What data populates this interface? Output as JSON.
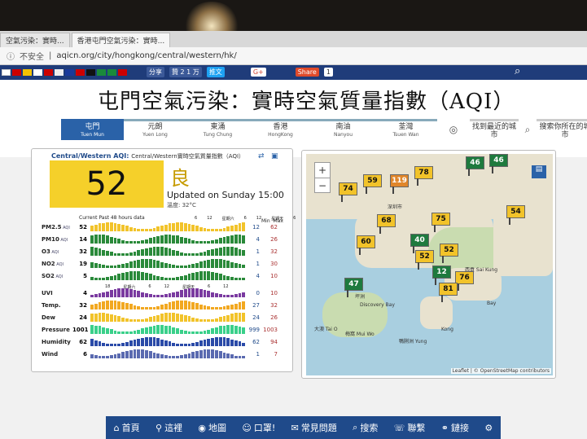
{
  "browser": {
    "tabs": [
      {
        "label": "空氣污染：實時..."
      },
      {
        "label": "香港屯門空氣污染：實時..."
      }
    ],
    "security": "不安全",
    "url": "aqicn.org/city/hongkong/central/western/hk/"
  },
  "social": {
    "share1": "分享",
    "likes": "贊 2 1 万",
    "tweet": "推文",
    "gplus": "G+",
    "share2": "Share",
    "count": "1"
  },
  "page_title": "屯門空氣污染：實時空氣質量指數（AQI）",
  "nav": [
    {
      "zh": "屯門",
      "en": "Tuen Mun"
    },
    {
      "zh": "元朗",
      "en": "Yuen Long"
    },
    {
      "zh": "東涌",
      "en": "Tung Chung"
    },
    {
      "zh": "香港",
      "en": "HongKong"
    },
    {
      "zh": "南油",
      "en": "Nanyou"
    },
    {
      "zh": "荃灣",
      "en": "Tsuen Wan"
    }
  ],
  "nav_right": [
    {
      "label": "找到最近的城市"
    },
    {
      "label": "搜索你所在的城市"
    }
  ],
  "station": {
    "name": "Central/Western",
    "head_suffix": "AQI:",
    "head_desc": "Central/Western實時空氣質量指數（AQI）",
    "aqi": "52",
    "level": "良",
    "updated": "Updated on Sunday 15:00",
    "temperature": "溫度: 32°C",
    "current_label": "Current  Past 48 hours data",
    "min_label": "Min",
    "max_label": "Max",
    "tick_labels": [
      "6",
      "12",
      "星期六",
      "6",
      "12",
      "星期天",
      "6",
      "12"
    ],
    "tick_labels2": [
      "18",
      "星期六",
      "6",
      "12",
      "星期天",
      "6",
      "12"
    ]
  },
  "pollutants": [
    {
      "name": "PM2.5",
      "unit": "AQI",
      "current": 52,
      "min": 12,
      "max": 62,
      "color": "#f2c32a"
    },
    {
      "name": "PM10",
      "unit": "AQI",
      "current": 14,
      "min": 4,
      "max": 26,
      "color": "#2a8a3a"
    },
    {
      "name": "O3",
      "unit": "AQI",
      "current": 32,
      "min": 1,
      "max": 32,
      "color": "#2a8a3a"
    },
    {
      "name": "NO2",
      "unit": "AQI",
      "current": 19,
      "min": 1,
      "max": 30,
      "color": "#2a8a3a"
    },
    {
      "name": "SO2",
      "unit": "AQI",
      "current": 5,
      "min": 4,
      "max": 10,
      "color": "#2a8a3a"
    },
    {
      "name": "UVI",
      "unit": "",
      "current": 4,
      "min": 0,
      "max": 10,
      "color": "#7a3aa0"
    },
    {
      "name": "Temp.",
      "unit": "",
      "current": 32,
      "min": 27,
      "max": 32,
      "color": "#f2a820"
    },
    {
      "name": "Dew",
      "unit": "",
      "current": 24,
      "min": 24,
      "max": 26,
      "color": "#f2c32a"
    },
    {
      "name": "Pressure",
      "unit": "",
      "current": 1001,
      "min": 999,
      "max": 1003,
      "color": "#3ad08a"
    },
    {
      "name": "Humidity",
      "unit": "",
      "current": 62,
      "min": 62,
      "max": 94,
      "color": "#2a4aa8"
    },
    {
      "name": "Wind",
      "unit": "",
      "current": 6,
      "min": 1,
      "max": 7,
      "color": "#5a6ab0"
    }
  ],
  "map": {
    "markers": [
      {
        "value": "74",
        "cls": "y"
      },
      {
        "value": "59",
        "cls": "y"
      },
      {
        "value": "119",
        "cls": "o"
      },
      {
        "value": "78",
        "cls": "y"
      },
      {
        "value": "46",
        "cls": "g"
      },
      {
        "value": "46",
        "cls": "g"
      },
      {
        "value": "68",
        "cls": "y"
      },
      {
        "value": "75",
        "cls": "y"
      },
      {
        "value": "54",
        "cls": "y"
      },
      {
        "value": "60",
        "cls": "y"
      },
      {
        "value": "40",
        "cls": "g"
      },
      {
        "value": "52",
        "cls": "y"
      },
      {
        "value": "52",
        "cls": "y"
      },
      {
        "value": "12",
        "cls": "g"
      },
      {
        "value": "76",
        "cls": "y"
      },
      {
        "value": "47",
        "cls": "g"
      },
      {
        "value": "81",
        "cls": "y"
      }
    ],
    "labels": [
      "深圳市",
      "Discovery Bay",
      "大澳 Tai O",
      "梅窩 Mui Wo",
      "Kong",
      "鴨脷洲 Yung",
      "西貢 Sai Kung",
      "坪洲",
      "Bay"
    ],
    "attribution": "Leaflet | © OpenStreetMap contributors"
  },
  "bottom_nav": [
    {
      "label": "首頁"
    },
    {
      "label": "這裡"
    },
    {
      "label": "地圖"
    },
    {
      "label": "口罩!"
    },
    {
      "label": "常見問題"
    },
    {
      "label": "搜索"
    },
    {
      "label": "聯繫"
    },
    {
      "label": "鏈接"
    }
  ]
}
